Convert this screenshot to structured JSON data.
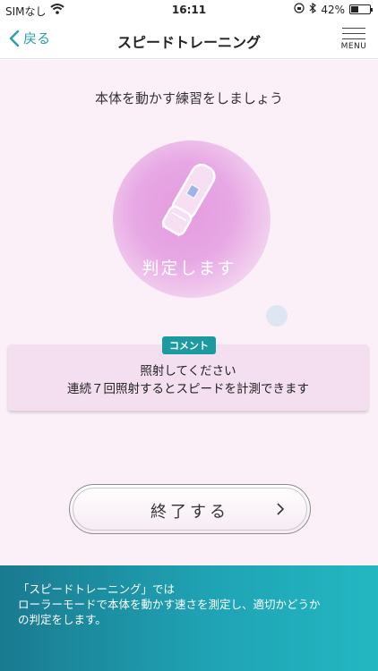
{
  "status_bar": {
    "carrier": "SIMなし",
    "time": "16:11",
    "battery_percent": "42%",
    "battery_level": 0.42
  },
  "nav": {
    "back_label": "戻る",
    "title": "スピードトレーニング",
    "menu_label": "MENU"
  },
  "main": {
    "instruction": "本体を動かす練習をしましょう",
    "judge_text": "判定します",
    "comment": {
      "badge": "コメント",
      "line1": "照射してください",
      "line2": "連続７回照射するとスピードを計測できます"
    },
    "end_button_label": "終了する"
  },
  "footer": {
    "line1": "「スピードトレーニング」では",
    "line2": "ローラーモードで本体を動かす速さを測定し、適切かどうか",
    "line3": "の判定をします。"
  },
  "colors": {
    "accent": "#2aa0b0",
    "badge": "#1b9aa0",
    "background": "#fcf0f8",
    "orb": "#e49be0"
  }
}
